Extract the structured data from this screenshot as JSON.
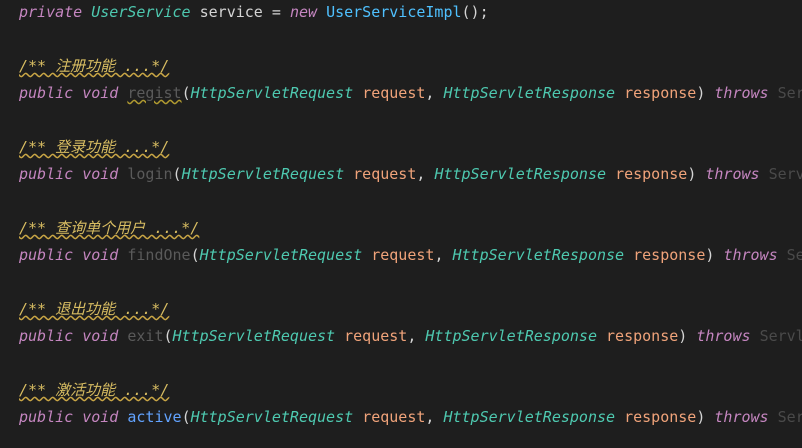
{
  "code": {
    "line1": {
      "kw": "private",
      "type": "UserService",
      "var": "service",
      "eq": "=",
      "new": "new",
      "cls": "UserServiceImpl",
      "rest": "();"
    },
    "methods": [
      {
        "comment": "/** 注册功能 ...*/",
        "public": "public",
        "void": "void",
        "name": "regist",
        "open": "(",
        "t1": "HttpServletRequest",
        "p1": "request",
        "comma": ",",
        "t2": "HttpServletResponse",
        "p2": "response",
        "close": ")",
        "throws": "throws",
        "tail": "Ser"
      },
      {
        "comment": "/** 登录功能 ...*/",
        "public": "public",
        "void": "void",
        "name": "login",
        "open": "(",
        "t1": "HttpServletRequest",
        "p1": "request",
        "comma": ",",
        "t2": "HttpServletResponse",
        "p2": "response",
        "close": ")",
        "throws": "throws",
        "tail": "Serv"
      },
      {
        "comment": "/** 查询单个用户 ...*/",
        "public": "public",
        "void": "void",
        "name": "findOne",
        "open": "(",
        "t1": "HttpServletRequest",
        "p1": "request",
        "comma": ",",
        "t2": "HttpServletResponse",
        "p2": "response",
        "close": ")",
        "throws": "throws",
        "tail": "Se"
      },
      {
        "comment": "/** 退出功能 ...*/",
        "public": "public",
        "void": "void",
        "name": "exit",
        "open": "(",
        "t1": "HttpServletRequest",
        "p1": "request",
        "comma": ",",
        "t2": "HttpServletResponse",
        "p2": "response",
        "close": ")",
        "throws": "throws",
        "tail": "Servl"
      },
      {
        "comment": "/** 激活功能 ...*/",
        "public": "public",
        "void": "void",
        "name": "active",
        "open": "(",
        "t1": "HttpServletRequest",
        "p1": "request",
        "comma": ",",
        "t2": "HttpServletResponse",
        "p2": "response",
        "close": ")",
        "throws": "throws",
        "tail": "Ser"
      }
    ]
  },
  "colors": {
    "background": "#1e1e1e",
    "keyword": "#c586c0",
    "type": "#4ec9b0",
    "comment": "#d8bd62",
    "param": "#f0a37a",
    "unused_method": "#5a5a5a"
  }
}
